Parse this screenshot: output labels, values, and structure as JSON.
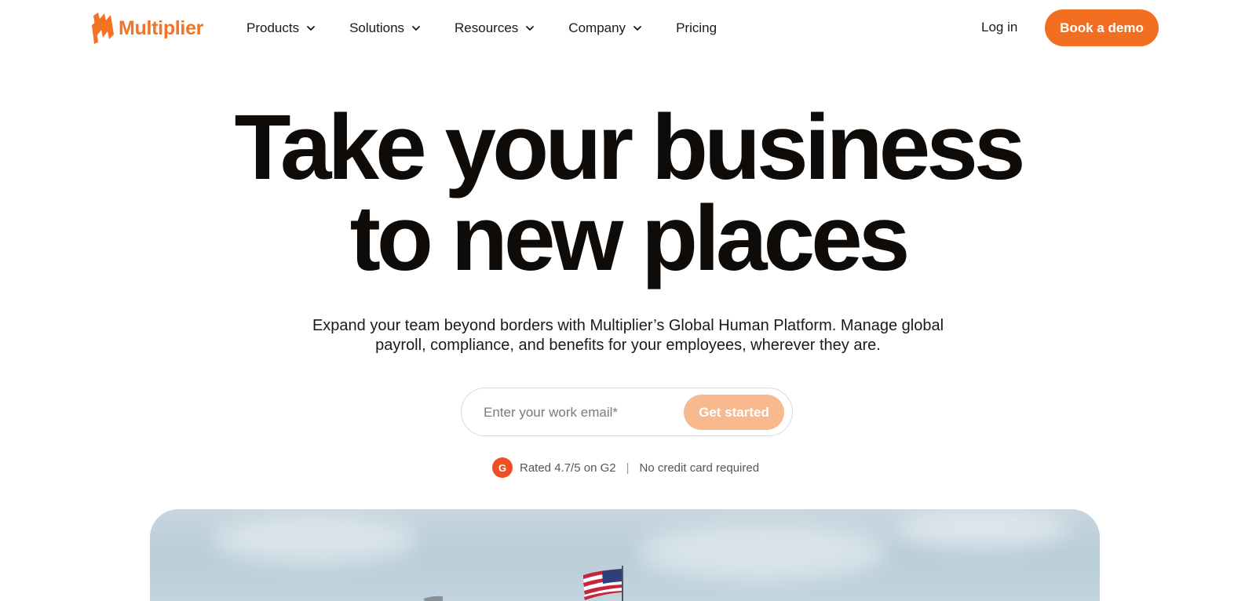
{
  "brand": {
    "name": "Multiplier",
    "accent_color": "#f26f21",
    "accent_light": "#f9b98f"
  },
  "nav": {
    "items": [
      {
        "label": "Products",
        "has_dropdown": true
      },
      {
        "label": "Solutions",
        "has_dropdown": true
      },
      {
        "label": "Resources",
        "has_dropdown": true
      },
      {
        "label": "Company",
        "has_dropdown": true
      },
      {
        "label": "Pricing",
        "has_dropdown": false
      }
    ],
    "login_label": "Log in",
    "demo_label": "Book a demo"
  },
  "hero": {
    "headline_line1": "Take your business",
    "headline_line2": "to new places",
    "subtext": "Expand your team beyond borders with Multiplier’s Global Human Platform. Manage global payroll, compliance, and benefits for your employees, wherever they are.",
    "email_placeholder": "Enter your work email*",
    "email_value": "",
    "cta_label": "Get started",
    "rating_text": "Rated 4.7/5 on G2",
    "separator": "|",
    "no_card_text": "No credit card required"
  },
  "icons": {
    "logo": "multiplier-logo-icon",
    "chevron": "chevron-down-icon",
    "g2": "g2-logo-icon",
    "flag": "american-flag-icon"
  }
}
